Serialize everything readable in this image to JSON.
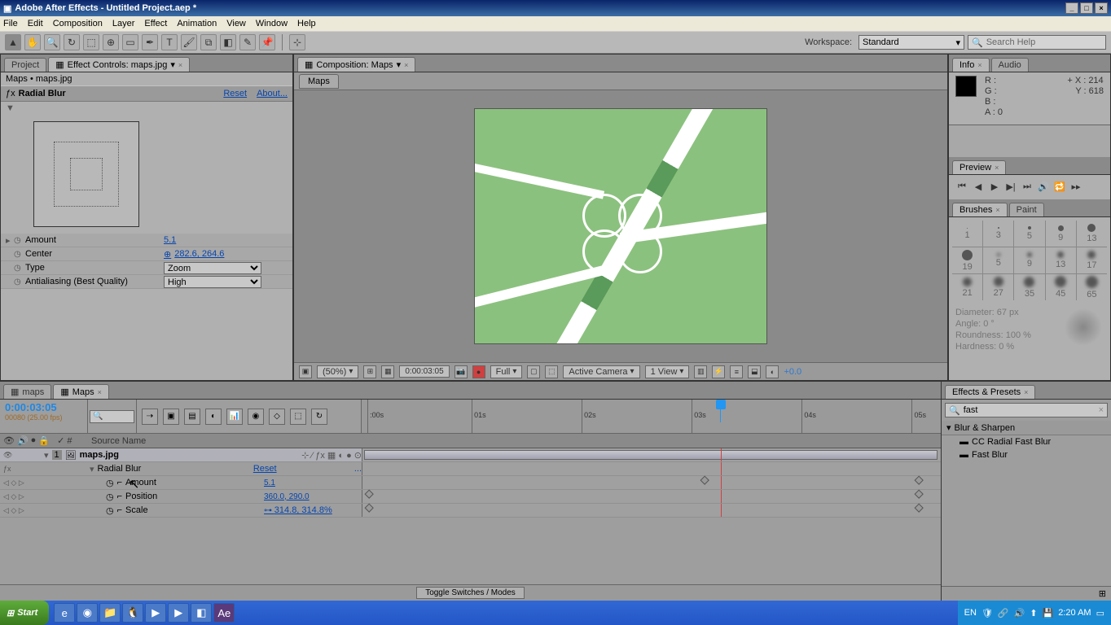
{
  "title_bar": {
    "app": "Adobe After Effects",
    "project": "Untitled Project.aep *"
  },
  "menu": [
    "File",
    "Edit",
    "Composition",
    "Layer",
    "Effect",
    "Animation",
    "View",
    "Window",
    "Help"
  ],
  "workspace": {
    "label": "Workspace:",
    "value": "Standard"
  },
  "search_help": {
    "placeholder": "Search Help"
  },
  "effect_controls": {
    "tab_project": "Project",
    "tab_ec": "Effect Controls: maps.jpg",
    "breadcrumb": "Maps • maps.jpg",
    "fx_name": "Radial Blur",
    "reset": "Reset",
    "about": "About...",
    "props": {
      "amount": {
        "label": "Amount",
        "value": "5.1"
      },
      "center": {
        "label": "Center",
        "value": "282.6, 264.6"
      },
      "type": {
        "label": "Type",
        "value": "Zoom"
      },
      "aa": {
        "label": "Antialiasing (Best Quality)",
        "value": "High"
      }
    }
  },
  "composition": {
    "tab_label": "Composition: Maps",
    "active_tab": "Maps",
    "footer": {
      "zoom": "(50%)",
      "timecode": "0:00:03:05",
      "quality": "Full",
      "camera": "Active Camera",
      "views": "1 View",
      "exposure": "+0.0"
    }
  },
  "info": {
    "tab_info": "Info",
    "tab_audio": "Audio",
    "r": "R :",
    "g": "G :",
    "b": "B :",
    "a": "A : 0",
    "x": "X : 214",
    "y": "Y : 618"
  },
  "preview": {
    "tab": "Preview"
  },
  "brushes": {
    "tab_brushes": "Brushes",
    "tab_paint": "Paint",
    "sizes_r1": [
      ".",
      "1",
      "3",
      "5",
      "9",
      "13"
    ],
    "sizes_r2": [
      "•",
      "19",
      "5",
      "9",
      "13",
      "17"
    ],
    "sizes_r3": [
      "○",
      "21",
      "27",
      "35",
      "45",
      "65"
    ],
    "diameter": "Diameter: 67 px",
    "angle": "Angle: 0 °",
    "roundness": "Roundness: 100 %",
    "hardness": "Hardness: 0 %"
  },
  "timeline": {
    "tab_lower": "maps",
    "tab_active": "Maps",
    "timecode": "0:00:03:05",
    "frames": "00080 (25.00 fps)",
    "ruler": [
      ":00s",
      "01s",
      "02s",
      "03s",
      "04s",
      "05s"
    ],
    "col_source": "Source Name",
    "layer": {
      "num": "1",
      "name": "maps.jpg"
    },
    "fx_row": {
      "name": "Radial Blur",
      "reset": "Reset",
      "more": "..."
    },
    "amount": {
      "name": "Amount",
      "value": "5.1"
    },
    "position": {
      "name": "Position",
      "value": "360.0, 290.0"
    },
    "scale": {
      "name": "Scale",
      "value": "314.8, 314.8%"
    },
    "footer_toggle": "Toggle Switches / Modes"
  },
  "effects_presets": {
    "tab": "Effects & Presets",
    "search": "fast",
    "category": "Blur & Sharpen",
    "items": [
      "CC Radial Fast Blur",
      "Fast Blur"
    ]
  },
  "taskbar": {
    "start": "Start",
    "lang": "EN",
    "time": "2:20 AM"
  }
}
